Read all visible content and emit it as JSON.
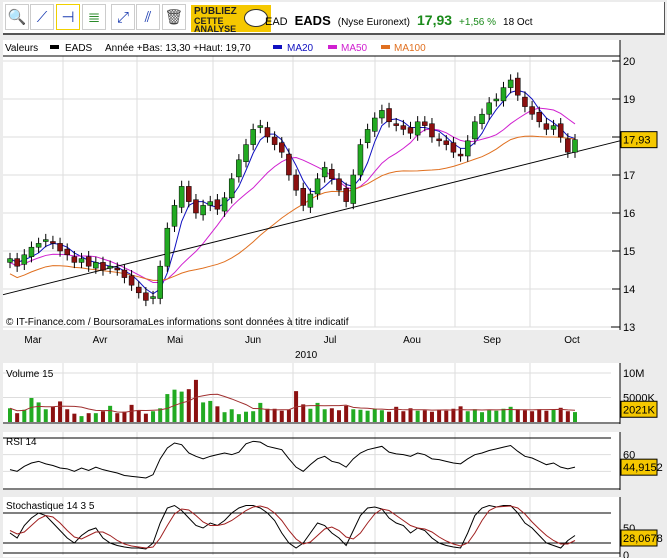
{
  "toolbar": {
    "buttons": [
      "zoom-icon",
      "trendline-icon",
      "horizontal-line-icon",
      "indicator-icon",
      "channel-icon",
      "parallel-line-icon",
      "trash-icon"
    ],
    "publiez": [
      "PUBLIEZ",
      "CETTE",
      "ANALYSE"
    ]
  },
  "quote": {
    "code": "EAD",
    "name": "EADS",
    "market": "(Nyse Euronext)",
    "price": "17,93",
    "change": "+1,56 %",
    "date": "18 Oct",
    "color_up": "#1a8a1a"
  },
  "legend": {
    "valeurs": "Valeurs",
    "series": "EADS",
    "range": "Année +Bas: 13,30 +Haut: 19,70",
    "ma20": "MA20",
    "ma50": "MA50",
    "ma100": "MA100"
  },
  "colors": {
    "ma20": "#1010c0",
    "ma50": "#d020d0",
    "ma100": "#e07020",
    "up": "#22aa22",
    "down": "#8b1010",
    "badge": "#f5c800"
  },
  "copyright": "© IT-Finance.com / BoursoramaLes informations sont données à titre indicatif",
  "chart_data": [
    {
      "type": "candlestick",
      "title": "EADS",
      "year": "2010",
      "months": [
        "Mar",
        "Avr",
        "Mai",
        "Jun",
        "Jul",
        "Aou",
        "Sep",
        "Oct"
      ],
      "ylim": [
        13,
        20
      ],
      "yticks": [
        "13",
        "14",
        "15",
        "16",
        "17",
        "18",
        "19",
        "20"
      ],
      "last_label": "17,93",
      "close": [
        14.8,
        14.6,
        14.9,
        15.1,
        15.2,
        15.3,
        15.2,
        15.0,
        14.9,
        14.7,
        14.8,
        14.6,
        14.7,
        14.5,
        14.6,
        14.5,
        14.3,
        14.1,
        13.9,
        13.7,
        13.8,
        14.6,
        15.6,
        16.2,
        16.7,
        16.3,
        16.0,
        16.2,
        16.3,
        16.1,
        16.4,
        16.9,
        17.4,
        17.8,
        18.2,
        18.3,
        18.0,
        17.8,
        17.6,
        17.0,
        16.6,
        16.2,
        16.5,
        16.9,
        17.2,
        16.9,
        16.6,
        16.3,
        17.0,
        17.8,
        18.2,
        18.5,
        18.7,
        18.4,
        18.3,
        18.2,
        18.1,
        18.4,
        18.3,
        18.0,
        17.9,
        17.8,
        17.6,
        17.5,
        17.9,
        18.4,
        18.6,
        18.9,
        19.0,
        19.3,
        19.5,
        19.1,
        18.8,
        18.6,
        18.4,
        18.2,
        18.3,
        18.0,
        17.6,
        17.93
      ],
      "trendline": [
        13.85,
        17.9
      ]
    },
    {
      "type": "bar",
      "title": "Volume 15",
      "yticks": [
        "10M",
        "5000K"
      ],
      "ymax": 10000,
      "last_label": "2021K",
      "values": [
        2800,
        1800,
        2500,
        4900,
        4000,
        2600,
        3100,
        4200,
        2600,
        1700,
        1200,
        1800,
        1800,
        2200,
        3300,
        1800,
        2100,
        3500,
        2400,
        1700,
        2200,
        2800,
        5700,
        6600,
        6200,
        6700,
        8600,
        4000,
        4300,
        3200,
        2000,
        2600,
        1600,
        2100,
        2200,
        3900,
        2700,
        2700,
        2300,
        2500,
        6300,
        3600,
        2700,
        3900,
        2600,
        2800,
        2400,
        3300,
        2600,
        2500,
        2300,
        2700,
        2400,
        2100,
        3100,
        2200,
        2800,
        2300,
        2400,
        2100,
        2500,
        2300,
        2700,
        3200,
        2200,
        2600,
        2000,
        2400,
        2300,
        2700,
        3100,
        2600,
        2400,
        2200,
        2600,
        2300,
        2500,
        2900,
        2200,
        2021
      ]
    },
    {
      "type": "line",
      "title": "RSI 14",
      "yticks": [
        "60"
      ],
      "last_label": "44,9152",
      "values": [
        42,
        40,
        46,
        50,
        52,
        49,
        47,
        44,
        43,
        40,
        44,
        41,
        45,
        42,
        40,
        38,
        35,
        34,
        33,
        32,
        36,
        55,
        68,
        74,
        72,
        62,
        58,
        55,
        58,
        60,
        62,
        60,
        63,
        73,
        76,
        75,
        70,
        68,
        66,
        55,
        45,
        40,
        48,
        55,
        58,
        52,
        50,
        45,
        55,
        62,
        66,
        68,
        70,
        63,
        61,
        60,
        58,
        62,
        60,
        55,
        54,
        52,
        50,
        49,
        55,
        60,
        62,
        65,
        67,
        69,
        71,
        64,
        58,
        56,
        52,
        48,
        50,
        45,
        43,
        45
      ]
    },
    {
      "type": "line",
      "title": "Stochastique 14 3 5",
      "yticks": [
        "50",
        "0"
      ],
      "last_label": "28,0678",
      "values": [
        40,
        30,
        55,
        70,
        80,
        75,
        60,
        45,
        30,
        20,
        35,
        45,
        50,
        30,
        20,
        15,
        12,
        10,
        10,
        8,
        20,
        60,
        90,
        95,
        85,
        70,
        55,
        50,
        60,
        55,
        65,
        80,
        90,
        95,
        95,
        90,
        80,
        65,
        40,
        20,
        10,
        20,
        40,
        60,
        55,
        40,
        30,
        15,
        45,
        75,
        90,
        92,
        88,
        70,
        60,
        55,
        40,
        50,
        45,
        30,
        20,
        15,
        12,
        10,
        40,
        75,
        90,
        95,
        92,
        95,
        95,
        80,
        60,
        50,
        35,
        20,
        15,
        10,
        25,
        35
      ],
      "signal": [
        45,
        38,
        42,
        55,
        68,
        75,
        72,
        60,
        45,
        32,
        28,
        35,
        42,
        42,
        35,
        25,
        18,
        14,
        12,
        10,
        12,
        30,
        55,
        78,
        88,
        86,
        75,
        62,
        55,
        55,
        58,
        65,
        75,
        85,
        92,
        94,
        90,
        80,
        65,
        45,
        28,
        18,
        22,
        35,
        48,
        52,
        45,
        32,
        28,
        40,
        60,
        78,
        88,
        85,
        75,
        65,
        55,
        50,
        48,
        42,
        32,
        24,
        18,
        14,
        20,
        40,
        65,
        85,
        92,
        93,
        94,
        90,
        78,
        62,
        48,
        35,
        25,
        18,
        18,
        25
      ]
    }
  ]
}
